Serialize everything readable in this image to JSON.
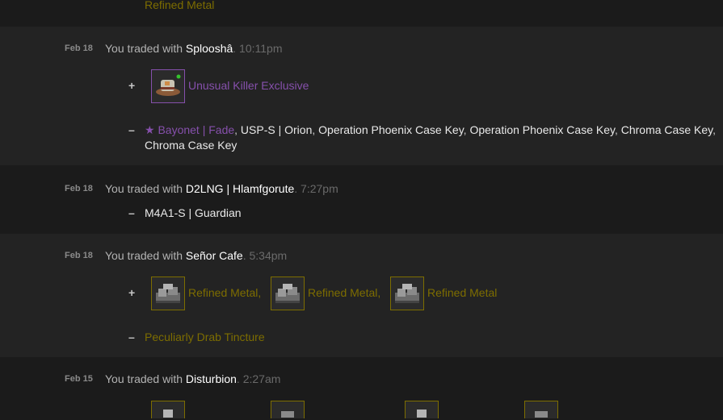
{
  "top_item": {
    "name": "Refined Metal"
  },
  "trades": [
    {
      "date": "Feb 18",
      "prefix": "You traded with ",
      "partner": "Splooshâ",
      "time": ". 10:11pm",
      "received_sign": "+",
      "received": [
        {
          "name": "Unusual Killer Exclusive",
          "icon": "hat-icon",
          "color": "#8650ac"
        }
      ],
      "given_sign": "–",
      "given_line1": [
        {
          "name": "★ Bayonet | Fade",
          "color": "#8650ac"
        },
        {
          "name": "USP-S | Orion"
        },
        {
          "name": "Operation Phoenix Case Key"
        },
        {
          "name": "Operation Phoenix Case Key"
        },
        {
          "name": "Chroma Case Key"
        }
      ],
      "given_line2": [
        {
          "name": "Chroma Case Key"
        }
      ]
    },
    {
      "date": "Feb 18",
      "prefix": "You traded with ",
      "partner": "D2LNG | Hlamfgorute",
      "time": ". 7:27pm",
      "given_sign": "–",
      "given": [
        {
          "name": "M4A1-S | Guardian"
        }
      ]
    },
    {
      "date": "Feb 18",
      "prefix": "You traded with ",
      "partner": "Señor Cafe",
      "time": ". 5:34pm",
      "received_sign": "+",
      "received": [
        {
          "name": "Refined Metal",
          "icon": "refined-metal-icon",
          "color": "#7d6d00"
        },
        {
          "name": "Refined Metal",
          "icon": "refined-metal-icon",
          "color": "#7d6d00"
        },
        {
          "name": "Refined Metal",
          "icon": "refined-metal-icon",
          "color": "#7d6d00"
        }
      ],
      "given_sign": "–",
      "given": [
        {
          "name": "Peculiarly Drab Tincture",
          "color": "#7d6d00"
        }
      ]
    },
    {
      "date": "Feb 15",
      "prefix": "You traded with ",
      "partner": "Disturbion",
      "time": ". 2:27am"
    }
  ],
  "separator": ", "
}
